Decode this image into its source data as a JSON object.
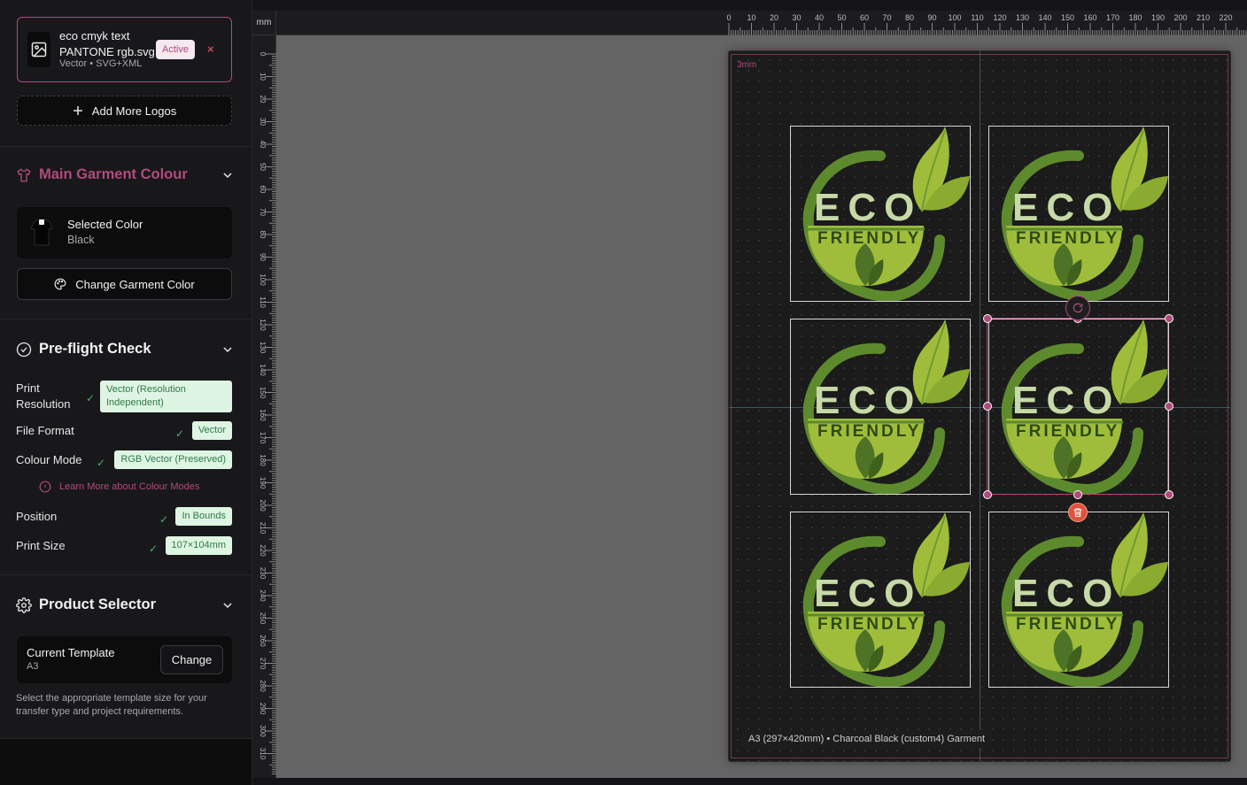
{
  "logo_file": {
    "name_line1": "eco cmyk text",
    "name_line2": "PANTONE rgb.svg",
    "meta": "Vector • SVG+XML",
    "status": "Active",
    "remove_icon": "×"
  },
  "add_logos_label": "Add More Logos",
  "garment": {
    "title": "Main Garment Colour",
    "selected_label": "Selected Color",
    "selected_value": "Black",
    "change_label": "Change Garment Color"
  },
  "preflight": {
    "title": "Pre-flight Check",
    "rows": [
      {
        "label": "Print Resolution",
        "value": "Vector (Resolution Independent)"
      },
      {
        "label": "File Format",
        "value": "Vector"
      },
      {
        "label": "Colour Mode",
        "value": "RGB Vector (Preserved)"
      },
      {
        "label": "Position",
        "value": "In Bounds"
      },
      {
        "label": "Print Size",
        "value": "107×104mm"
      }
    ],
    "learn_more": "Learn More about Colour Modes"
  },
  "product": {
    "title": "Product Selector",
    "template_label": "Current Template",
    "template_value": "A3",
    "change_label": "Change",
    "help": "Select the appropriate template size for your transfer type and project requirements."
  },
  "canvas": {
    "unit": "mm",
    "bleed_label": "3mm",
    "caption": "A3 (297×420mm) • Charcoal Black (custom4) Garment",
    "logo_text_top": "ECO",
    "logo_text_bottom": "FRIENDLY"
  },
  "rulers": {
    "h_labels": [
      "0",
      "10",
      "20",
      "30",
      "40",
      "50",
      "60",
      "70",
      "80",
      "90",
      "100",
      "110",
      "120",
      "130",
      "140",
      "150",
      "160",
      "170",
      "180",
      "190",
      "200",
      "210",
      "220"
    ],
    "v_labels": [
      "0",
      "10",
      "20",
      "30",
      "40",
      "50",
      "60",
      "70",
      "80",
      "90",
      "100",
      "110",
      "120",
      "130",
      "140",
      "150",
      "160",
      "170",
      "180",
      "190",
      "200",
      "210",
      "220",
      "230",
      "240",
      "250",
      "260",
      "270",
      "280",
      "290",
      "300",
      "310"
    ]
  },
  "colors": {
    "accent": "#b04a7c",
    "logo_dark_green": "#5e8a2e",
    "logo_light_green": "#9fbd3a",
    "logo_text": "#c6d9a6",
    "status_green": "#4caf6a"
  }
}
